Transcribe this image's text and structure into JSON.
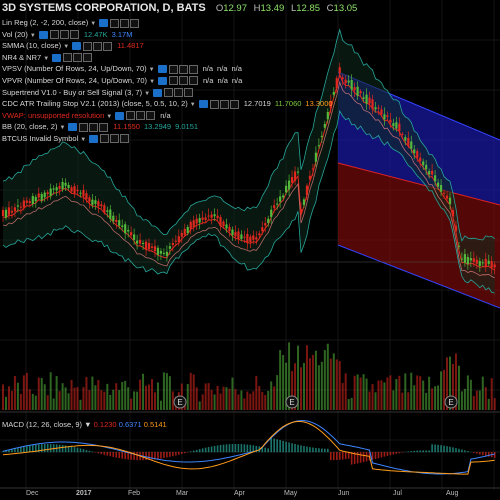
{
  "header": {
    "symbol": "3D SYSTEMS CORPORATION, D, BATS",
    "ohlc": [
      {
        "label": "O",
        "value": "12.97"
      },
      {
        "label": "H",
        "value": "13.49"
      },
      {
        "label": "L",
        "value": "12.85"
      },
      {
        "label": "C",
        "value": "13.05"
      }
    ]
  },
  "indicators": [
    {
      "id": "linreg",
      "label": "Lin Reg (2, -2, 200, close)",
      "values": []
    },
    {
      "id": "vol",
      "label": "Vol (20)",
      "values": [
        {
          "text": "12.47K",
          "color": "#26a69a"
        },
        {
          "text": "3.17M",
          "color": "#3d85ff"
        }
      ]
    },
    {
      "id": "smma",
      "label": "SMMA (10, close)",
      "values": [
        {
          "text": "11.4817",
          "color": "#e0281f"
        }
      ]
    },
    {
      "id": "nr4",
      "label": "NR4 & NR7",
      "values": []
    },
    {
      "id": "vpsv",
      "label": "VPSV (Number Of Rows, 24, Up/Down, 70)",
      "values": [
        {
          "text": "n/a",
          "color": "#d8d8d8"
        },
        {
          "text": "n/a",
          "color": "#d8d8d8"
        },
        {
          "text": "n/a",
          "color": "#d8d8d8"
        }
      ]
    },
    {
      "id": "vpvr",
      "label": "VPVR (Number Of Rows, 24, Up/Down, 70)",
      "values": [
        {
          "text": "n/a",
          "color": "#d8d8d8"
        },
        {
          "text": "n/a",
          "color": "#d8d8d8"
        },
        {
          "text": "n/a",
          "color": "#d8d8d8"
        }
      ]
    },
    {
      "id": "supertrend",
      "label": "Supertrend V1.0 - Buy or Sell Signal (3, 7)",
      "values": []
    },
    {
      "id": "cdc",
      "label": "CDC ATR Trailing Stop V2.1 (2013) (close, 5, 0.5, 10, 2)",
      "values": [
        {
          "text": "12.7019",
          "color": "#d8d8d8"
        },
        {
          "text": "11.7060",
          "color": "#7ccd3d"
        },
        {
          "text": "13.3000",
          "color": "#ff9c1a"
        }
      ]
    },
    {
      "id": "vwap",
      "label": "VWAP: unsupported resolution",
      "error": true,
      "values": [
        {
          "text": "n/a",
          "color": "#d8d8d8"
        }
      ]
    },
    {
      "id": "bb",
      "label": "BB (20, close, 2)",
      "values": [
        {
          "text": "11.1550",
          "color": "#e0281f"
        },
        {
          "text": "13.2949",
          "color": "#26a69a"
        },
        {
          "text": "9.0151",
          "color": "#26a69a"
        }
      ]
    },
    {
      "id": "btcus",
      "label": "BTCUS Invalid Symbol",
      "values": []
    }
  ],
  "macd": {
    "label": "MACD (12, 26, close, 9)",
    "values": [
      {
        "text": "0.1230",
        "color": "#e0281f"
      },
      {
        "text": "0.6371",
        "color": "#3d85ff"
      },
      {
        "text": "0.5141",
        "color": "#ff9c1a"
      }
    ]
  },
  "xaxis": [
    "Dec",
    "2017",
    "Feb",
    "Mar",
    "Apr",
    "May",
    "Jun",
    "Jul",
    "Aug"
  ],
  "earnings_marker": "E",
  "colors": {
    "bull": "#53b83c",
    "bear": "#e0281f",
    "channel_up": "#1a1aa8",
    "channel_down": "#8a0c0c",
    "macd": "#3d85ff",
    "signal": "#ff9c1a"
  }
}
